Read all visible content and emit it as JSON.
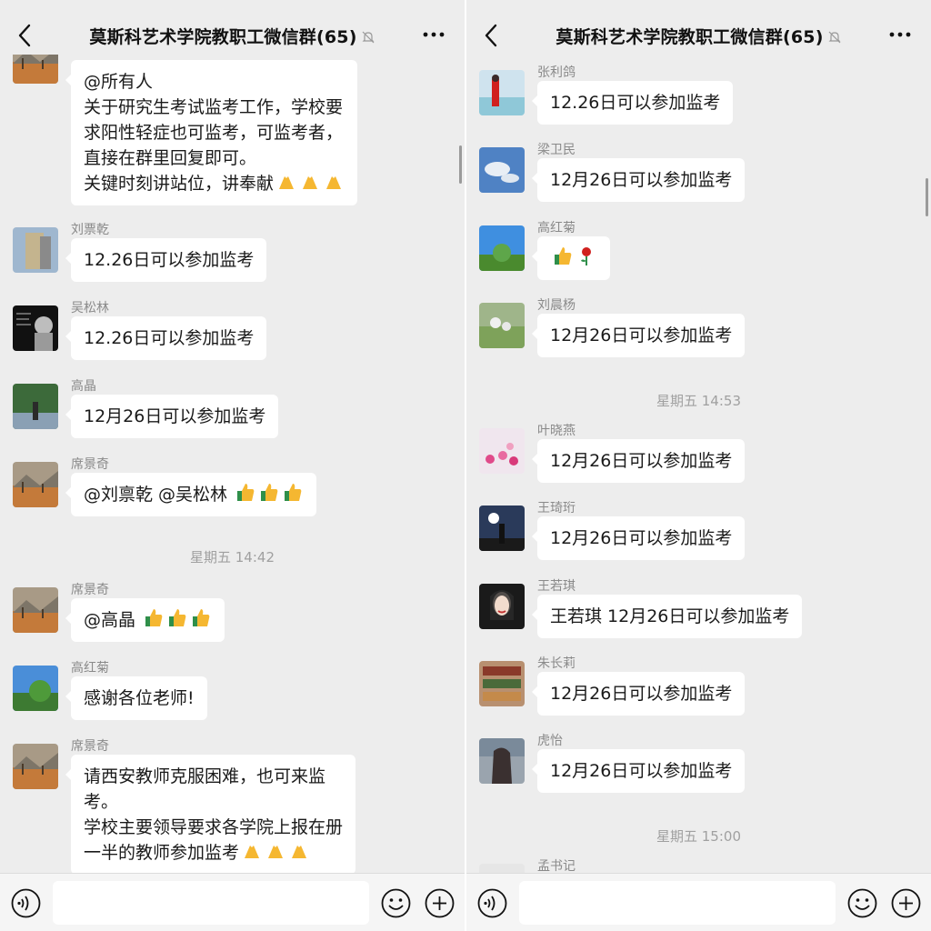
{
  "left": {
    "title": "莫斯科艺术学院教职工微信群(65)",
    "messages": [
      {
        "sender": "",
        "text": "@所有人\n关于研究生考试监考工作，学校要\n求阳性轻症也可监考，可监考者，\n直接在群里回复即可。\n关键时刻讲站位，讲奉献",
        "emoji": "pray-icon",
        "emoji_count": 3
      },
      {
        "sender": "刘票乾",
        "text": "12.26日可以参加监考"
      },
      {
        "sender": "吴松林",
        "text": "12.26日可以参加监考"
      },
      {
        "sender": "高晶",
        "text": "12月26日可以参加监考"
      },
      {
        "sender": "席景奇",
        "text": "@刘禀乾 @吴松林 ",
        "emoji": "thumbs-up-icon",
        "emoji_count": 3
      },
      {
        "sender": "席景奇",
        "text": "@高晶 ",
        "emoji": "thumbs-up-icon",
        "emoji_count": 3
      },
      {
        "sender": "高红菊",
        "text": "感谢各位老师!"
      },
      {
        "sender": "席景奇",
        "text": "请西安教师克服困难，也可来监\n考。\n学校主要领导要求各学院上报在册\n一半的教师参加监考",
        "emoji": "pray-icon",
        "emoji_count": 3
      }
    ],
    "time_1": "星期五 14:42"
  },
  "right": {
    "title": "莫斯科艺术学院教职工微信群(65)",
    "messages": [
      {
        "sender": "张利鸽",
        "text": "12.26日可以参加监考"
      },
      {
        "sender": "梁卫民",
        "text": "12月26日可以参加监考"
      },
      {
        "sender": "高红菊",
        "text": "",
        "emoji": "thumbs-up-rose",
        "emoji_count": 1
      },
      {
        "sender": "刘晨杨",
        "text": "12月26日可以参加监考"
      },
      {
        "sender": "叶晓燕",
        "text": "12月26日可以参加监考"
      },
      {
        "sender": "王琦珩",
        "text": "12月26日可以参加监考"
      },
      {
        "sender": "王若琪",
        "text": "王若琪 12月26日可以参加监考"
      },
      {
        "sender": "朱长莉",
        "text": "12月26日可以参加监考"
      },
      {
        "sender": "虎怡",
        "text": "12月26日可以参加监考"
      },
      {
        "sender": "孟书记",
        "text": ""
      }
    ],
    "time_1": "星期五 14:53",
    "time_2": "星期五 15:00"
  },
  "colors": {
    "background": "#ededed",
    "bubble": "#ffffff",
    "sender": "#8a8a8a",
    "time": "#a0a0a0"
  }
}
